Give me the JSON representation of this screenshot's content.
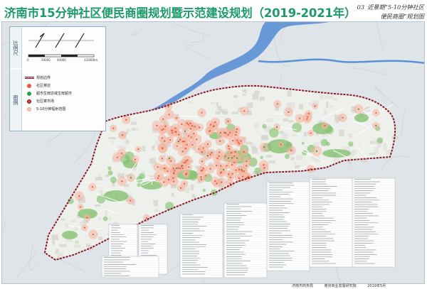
{
  "header": {
    "title": "济南市15分钟社区便民商圈规划暨示范建设规划（2019-2021年）",
    "sheet_number": "03",
    "sheet_title_line1": "近景期“5-10分钟社区",
    "sheet_title_line2": "便民商圈”规划图"
  },
  "legend": {
    "scale_heading": "比例尺",
    "legend_heading": "图例",
    "scale_ticks": [
      "0",
      "20000",
      "40000",
      "120000m"
    ],
    "items": [
      {
        "label": "规划边界",
        "symbol": "boundary"
      },
      {
        "label": "社区菜店",
        "symbol": "dot",
        "color": "#e8573a"
      },
      {
        "label": "超市生鲜店或生鲜超市",
        "symbol": "dot",
        "color": "#2f9b4a"
      },
      {
        "label": "社区菜市场",
        "symbol": "dot",
        "color": "#e33b2e"
      },
      {
        "label": "5-10分钟辐射范围",
        "symbol": "ring",
        "color": "#f2a68e"
      }
    ]
  },
  "footer": {
    "org1": "济南市商务局",
    "org2": "南京商业发展研究院",
    "date": "2019年5月"
  },
  "colors": {
    "title": "#1f9a6b",
    "river": "#5b8fd6",
    "boundary": "#8b1a2a",
    "green": "#7fbf6a",
    "circle": "#f39a80",
    "dot": "#e8573a"
  }
}
